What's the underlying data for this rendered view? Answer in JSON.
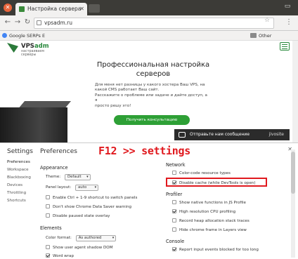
{
  "browser": {
    "tab_title": "Настройка сервера",
    "url": "vpsadm.ru",
    "bookmarks": [
      "Google SERPs Е",
      "Other bookmarks"
    ]
  },
  "page": {
    "logo_name": "VPS",
    "logo_name_accent": "adm",
    "logo_sub": "настраиваем серверы",
    "title": "Профессиональная настройка серверов",
    "text_lines": [
      "Для меня нет разницы у какого хостера Ваш VPS, на",
      "какой CMS работает Ваш сайт.",
      "Расскажите о проблеме или задаче и дайте доступ, а я",
      "просто решу это!"
    ],
    "cta": "Получить консультацию",
    "chat_label": "Отправьте нам сообщение",
    "chat_brand": "jivosite"
  },
  "overlay_text": "F12 >> settings",
  "devtools": {
    "side_title": "Settings",
    "side_items": [
      "Preferences",
      "Workspace",
      "Blackboxing",
      "Devices",
      "Throttling",
      "Shortcuts"
    ],
    "pref_title": "Preferences",
    "appearance": {
      "title": "Appearance",
      "theme_label": "Theme:",
      "theme_value": "Default",
      "panel_label": "Panel layout:",
      "panel_value": "auto",
      "options": [
        "Enable Ctrl + 1-9 shortcut to switch panels",
        "Don't show Chrome Data Saver warning",
        "Disable paused state overlay"
      ]
    },
    "elements": {
      "title": "Elements",
      "color_label": "Color format:",
      "color_value": "As authored",
      "options": [
        "Show user agent shadow DOM",
        "Word wrap"
      ]
    },
    "network": {
      "title": "Network",
      "options": [
        "Color-code resource types",
        "Disable cache (while DevTools is open)"
      ]
    },
    "profiler": {
      "title": "Profiler",
      "options": [
        "Show native functions in JS Profile",
        "High resolution CPU profiling",
        "Record heap allocation stack traces",
        "Hide chrome frame in Layers view"
      ]
    },
    "console": {
      "title": "Console",
      "options": [
        "Report input events blocked for too long"
      ]
    }
  }
}
